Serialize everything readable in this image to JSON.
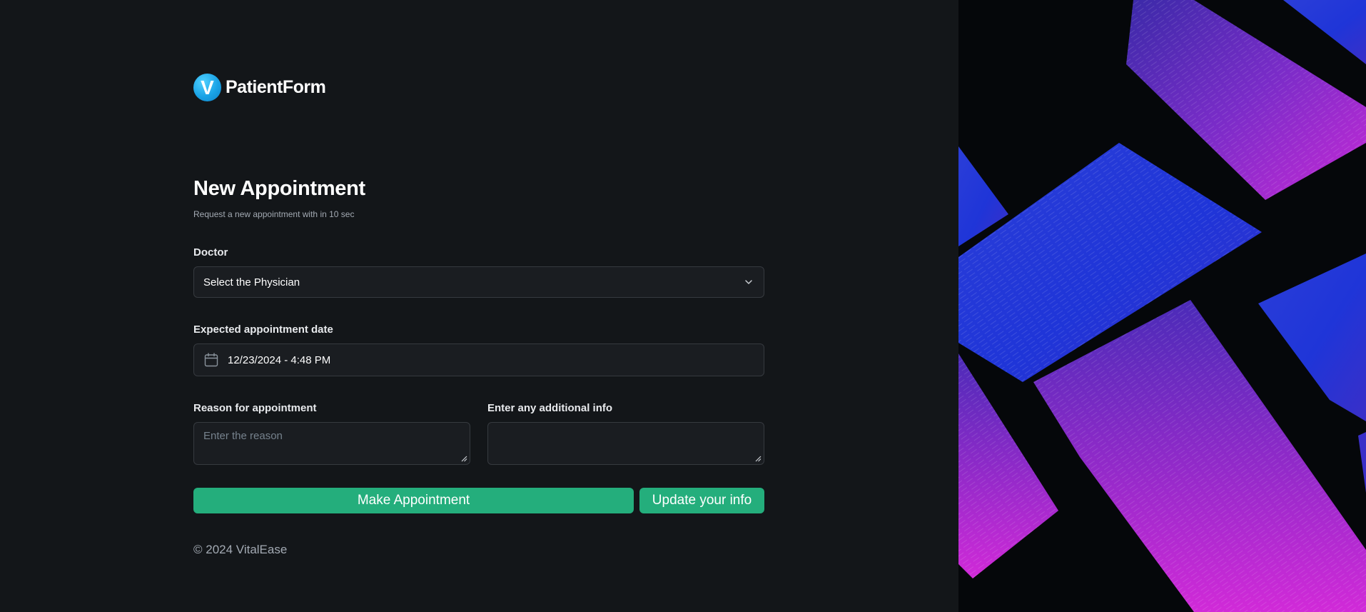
{
  "brand": {
    "logo_letter": "V",
    "name": "PatientForm"
  },
  "form": {
    "title": "New Appointment",
    "subtitle": "Request a new appointment with in 10 sec",
    "doctor": {
      "label": "Doctor",
      "selected": "Select the Physician"
    },
    "date": {
      "label": "Expected appointment date",
      "value": "12/23/2024 - 4:48 PM"
    },
    "reason": {
      "label": "Reason for appointment",
      "placeholder": "Enter the reason",
      "value": ""
    },
    "additional": {
      "label": "Enter any additional info",
      "placeholder": "",
      "value": ""
    },
    "buttons": {
      "submit": "Make Appointment",
      "update": "Update your info"
    }
  },
  "footer": {
    "copyright": "© 2024 VitalEase"
  },
  "colors": {
    "background": "#131619",
    "field": "#1a1d21",
    "accent": "#24ae7c",
    "brand_blue": "#1aa3e6"
  },
  "icons": {
    "logo": "brand-v-logo",
    "select": "chevron-down-icon",
    "date": "calendar-icon"
  }
}
